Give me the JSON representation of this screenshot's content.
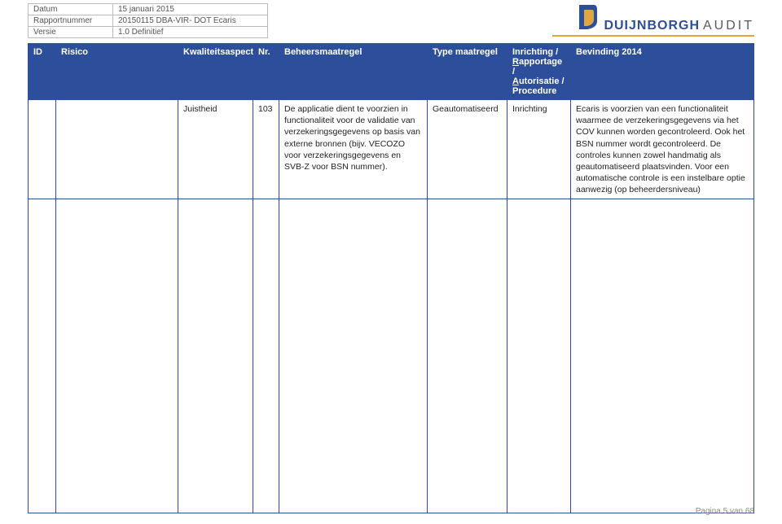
{
  "meta": {
    "datum_label": "Datum",
    "datum_value": "15 januari 2015",
    "rapportnummer_label": "Rapportnummer",
    "rapportnummer_value": "20150115 DBA-VIR- DOT Ecaris",
    "versie_label": "Versie",
    "versie_value": "1.0 Definitief"
  },
  "logo": {
    "name": "DUIJNBORGH",
    "suffix": "AUDIT"
  },
  "headers": {
    "id": "ID",
    "risico": "Risico",
    "kwaliteitsaspect": "Kwaliteitsaspect",
    "nr": "Nr.",
    "beheersmaatregel": "Beheersmaatregel",
    "type_maatregel": "Type maatregel",
    "inrichting_l1": "Inrichting /",
    "inrichting_l2_u": "R",
    "inrichting_l2_rest": "apportage /",
    "inrichting_l3_u": "A",
    "inrichting_l3_rest": "utorisatie /",
    "inrichting_l4": "Procedure",
    "bevinding": "Bevinding 2014"
  },
  "row": {
    "id": "",
    "risico": "",
    "kwaliteitsaspect": "Juistheid",
    "nr": "103",
    "beheersmaatregel": "De applicatie dient te voorzien in functionaliteit voor de validatie van verzekeringsgegevens op basis van externe bronnen (bijv. VECOZO voor verzekeringsgegevens en SVB-Z voor BSN nummer).",
    "type_maatregel": "Geautomatiseerd",
    "inrichting": "Inrichting",
    "bevinding": "Ecaris is voorzien van een functionaliteit waarmee de verzekeringsgegevens via het COV kunnen worden gecontroleerd. Ook het BSN nummer wordt gecontroleerd. De controles kunnen zowel handmatig als geautomatiseerd plaatsvinden. Voor een automatische controle is een instelbare optie aanwezig (op beheerdersniveau)"
  },
  "footer": "Pagina 5 van 68"
}
